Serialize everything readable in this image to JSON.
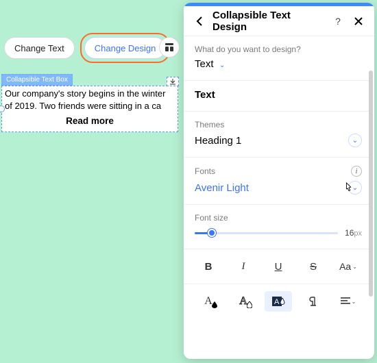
{
  "toolbar": {
    "change_text": "Change Text",
    "change_design": "Change Design"
  },
  "element": {
    "tag": "Collapsible Text Box",
    "body": "Our company's story begins in the winter of 2019. Two friends were sitting in a ca",
    "read_more": "Read more"
  },
  "panel": {
    "title": "Collapsible Text Design",
    "q1_label": "What do you want to design?",
    "q1_value": "Text",
    "tab": "Text",
    "themes_label": "Themes",
    "themes_value": "Heading 1",
    "fonts_label": "Fonts",
    "fonts_value": "Avenir Light",
    "fontsize_label": "Font size",
    "fontsize_value": "16",
    "fontsize_unit": "px",
    "fmt": {
      "b": "B",
      "i": "I",
      "u": "U",
      "s": "S",
      "aa": "Aa"
    },
    "fmt2": {
      "a1": "A",
      "a2": "A"
    }
  }
}
